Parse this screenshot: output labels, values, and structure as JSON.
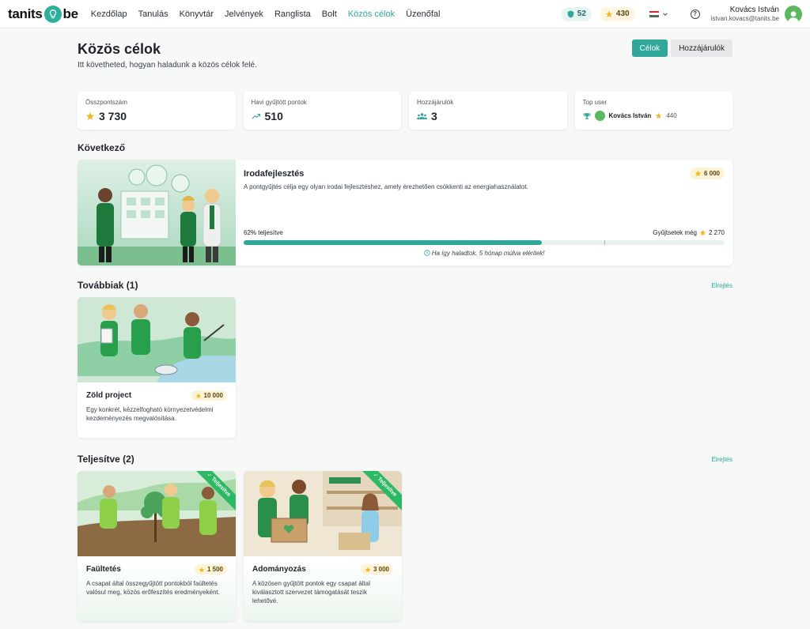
{
  "brand": {
    "left": "tanits",
    "right": "be"
  },
  "nav": [
    {
      "label": "Kezdőlap",
      "active": false
    },
    {
      "label": "Tanulás",
      "active": false
    },
    {
      "label": "Könyvtár",
      "active": false
    },
    {
      "label": "Jelvények",
      "active": false
    },
    {
      "label": "Ranglista",
      "active": false
    },
    {
      "label": "Bolt",
      "active": false
    },
    {
      "label": "Közös célok",
      "active": true
    },
    {
      "label": "Üzenőfal",
      "active": false
    }
  ],
  "header": {
    "shield_count": "52",
    "star_count": "430",
    "user_name": "Kovács István",
    "user_email": "istvan.kovacs@tanits.be"
  },
  "page": {
    "title": "Közös célok",
    "subtitle": "Itt követheted, hogyan haladunk a közös célok felé.",
    "btn_goals": "Célok",
    "btn_contributors": "Hozzájárulók"
  },
  "stats": {
    "total_label": "Összpontszám",
    "total_value": "3 730",
    "monthly_label": "Havi gyűjtött pontok",
    "monthly_value": "510",
    "contrib_label": "Hozzájárulók",
    "contrib_value": "3",
    "top_label": "Top user",
    "top_name": "Kovács István",
    "top_points": "440"
  },
  "next": {
    "section": "Következő",
    "title": "Irodafejlesztés",
    "points": "6 000",
    "desc": "A pontgyűjtés célja egy olyan irodai fejlesztéshez, amely érezhetően csökkenti az energiahasználatot.",
    "progress_label": "62% teljesítve",
    "progress": 0.62,
    "remaining_label": "Gyűjtsetek még",
    "remaining": "2 270",
    "eta": "Ha így haladtok, 5 hónap múlva eléritek!"
  },
  "upcoming": {
    "section": "Továbbiak (1)",
    "toggle": "Elrejtés",
    "items": [
      {
        "title": "Zöld project",
        "points": "10 000",
        "desc": "Egy konkrét, kézzelfogható környezetvédelmi kezdeményezés megvalósítása."
      }
    ]
  },
  "completed": {
    "section": "Teljesítve (2)",
    "toggle": "Elrejtés",
    "ribbon": "Teljesítve",
    "items": [
      {
        "title": "Faültetés",
        "points": "1 500",
        "desc": "A csapat által összegyűjtött pontokból faültetés valósul meg, közös erőfeszítés eredményeként."
      },
      {
        "title": "Adományozás",
        "points": "3 000",
        "desc": "A közösen gyűjtött pontok egy csapat által kiválasztott szervezet támogatását teszik lehetővé."
      }
    ]
  },
  "colors": {
    "accent": "#2fa79a",
    "star": "#f2b821",
    "ribbon": "#2db863"
  }
}
